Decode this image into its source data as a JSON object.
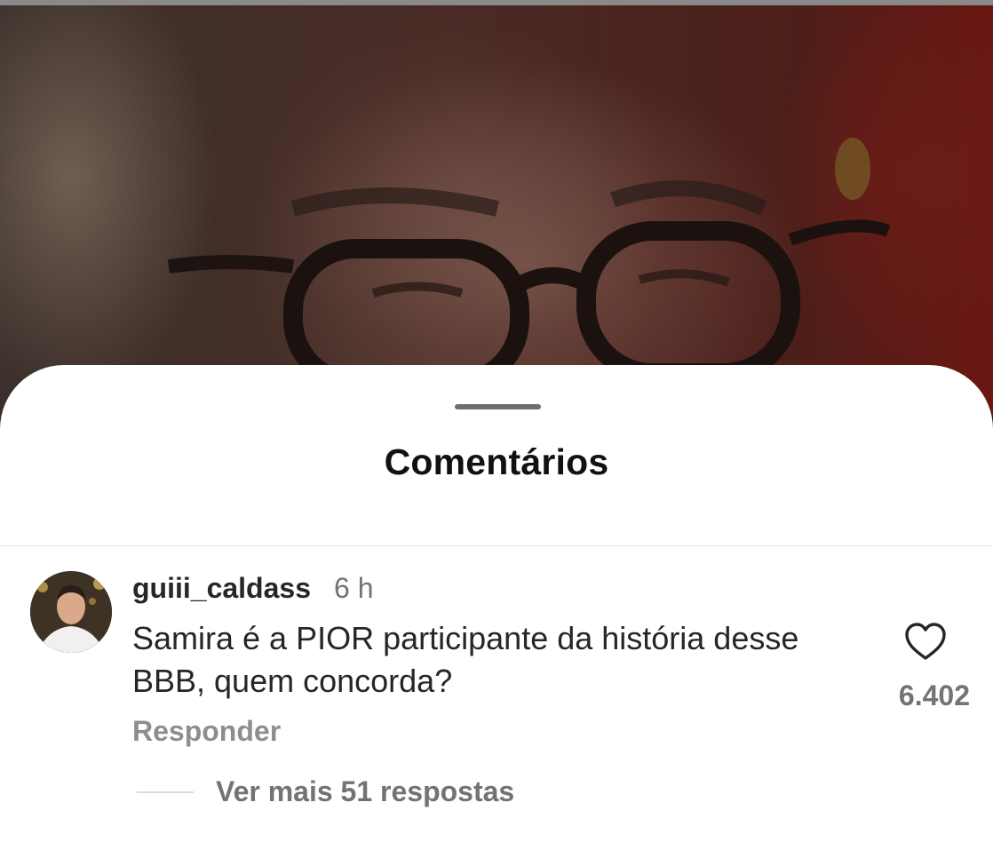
{
  "sheet": {
    "title": "Comentários"
  },
  "comment": {
    "username": "guiii_caldass",
    "time": "6 h",
    "text": "Samira é a PIOR participante da história desse BBB, quem concorda?",
    "likes": "6.402",
    "reply_label": "Responder",
    "view_replies_label": "Ver mais 51 respostas"
  },
  "icons": {
    "like": "heart-outline-icon"
  },
  "colors": {
    "sheet_bg": "#ffffff",
    "text_primary": "#262626",
    "text_secondary": "#737373"
  }
}
